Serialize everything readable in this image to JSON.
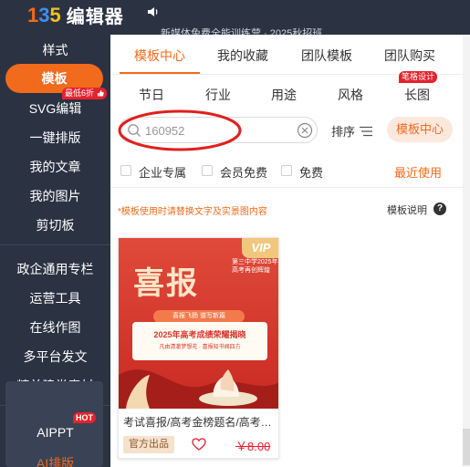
{
  "app": {
    "logo_letters": [
      "1",
      "3",
      "5"
    ],
    "logo_colors": [
      "#f26a1b",
      "#3d8ef0",
      "#f4c11a"
    ],
    "name": "编辑器",
    "scrolling_notice": "新媒体免费全能训练营 · 2025秋招班"
  },
  "sidebar": {
    "items": [
      {
        "label": "样式"
      },
      {
        "label": "模板",
        "badge": "最低6折"
      },
      {
        "label": "SVG编辑"
      },
      {
        "label": "一键排版"
      },
      {
        "label": "我的文章"
      },
      {
        "label": "我的图片"
      },
      {
        "label": "剪切板"
      },
      {
        "label": "政企通用专栏"
      },
      {
        "label": "运营工具"
      },
      {
        "label": "在线作图"
      },
      {
        "label": "多平台发文"
      },
      {
        "label": "精美建党素材"
      },
      {
        "label": "AIPPT",
        "badge": "HOT"
      },
      {
        "label": "AI排版"
      }
    ]
  },
  "main": {
    "tabs": [
      {
        "label": "模板中心",
        "active": true
      },
      {
        "label": "我的收藏"
      },
      {
        "label": "团队模板"
      },
      {
        "label": "团队购买"
      }
    ],
    "subtabs": [
      {
        "label": "节日"
      },
      {
        "label": "行业"
      },
      {
        "label": "用途"
      },
      {
        "label": "风格"
      },
      {
        "label": "长图",
        "badge": "笔格设计"
      }
    ],
    "search": {
      "value": "160952",
      "placeholder": ""
    },
    "sort_label": "排序",
    "center_pill": "模板中心",
    "filters": [
      {
        "label": "企业专属",
        "checked": false
      },
      {
        "label": "会员免费",
        "checked": false
      },
      {
        "label": "免费",
        "checked": false
      }
    ],
    "recent_label": "最近使用",
    "notice": "*模板使用时请替换文字及实景图内容",
    "explain_label": "模板说明",
    "help_glyph": "?",
    "card": {
      "vip": "VIP",
      "poster_title": "喜报",
      "poster_school": "第三中学2025年 高考再创辉煌",
      "poster_banner": "喜报飞扬 谱写新篇",
      "poster_headline": "2025年高考成绩荣耀揭晓",
      "poster_sub": "凡由清澈梦想花 · 喜报知书闻四方",
      "title": "考试喜报/高考金榜题名/高考喜报",
      "tag": "官方出品",
      "price": "￥8.00"
    }
  },
  "colors": {
    "accent": "#f26a1b",
    "sidebar_bg": "#2b3242",
    "badge_red": "#e4222e",
    "poster_red": "#d8382c"
  }
}
